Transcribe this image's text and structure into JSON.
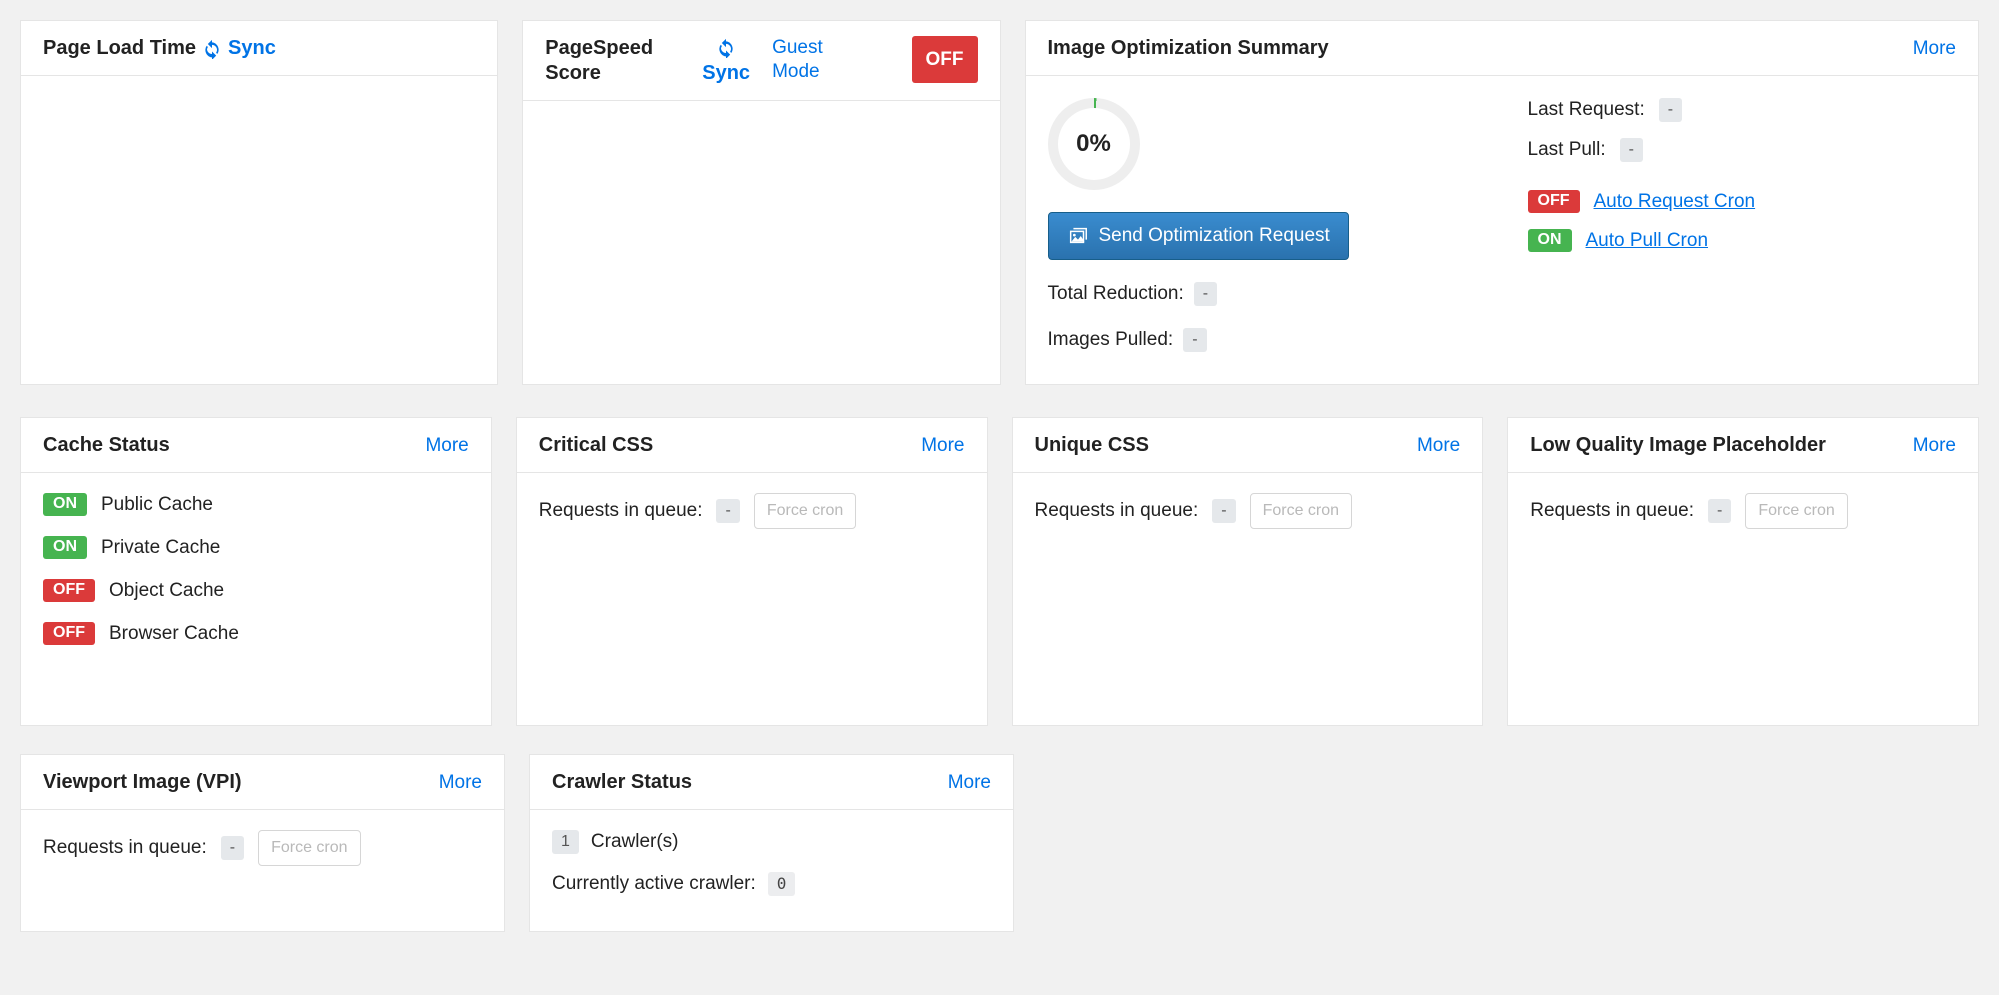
{
  "common": {
    "sync_label": "Sync",
    "more_label": "More",
    "force_cron_label": "Force cron",
    "requests_in_queue_label": "Requests in queue:",
    "off_label": "OFF",
    "on_label": "ON",
    "dash": "-"
  },
  "pageLoad": {
    "title": "Page Load Time"
  },
  "pageSpeed": {
    "title": "PageSpeed Score",
    "guest_mode_label": "Guest Mode"
  },
  "imageOpt": {
    "title": "Image Optimization Summary",
    "gauge_pct": "0%",
    "send_button": "Send Optimization Request",
    "total_reduction_label": "Total Reduction:",
    "total_reduction_val": "-",
    "images_pulled_label": "Images Pulled:",
    "images_pulled_val": "-",
    "last_request_label": "Last Request:",
    "last_request_val": "-",
    "last_pull_label": "Last Pull:",
    "last_pull_val": "-",
    "auto_request_cron_label": "Auto Request Cron",
    "auto_pull_cron_label": "Auto Pull Cron"
  },
  "cacheStatus": {
    "title": "Cache Status",
    "items": [
      {
        "state": "ON",
        "label": "Public Cache"
      },
      {
        "state": "ON",
        "label": "Private Cache"
      },
      {
        "state": "OFF",
        "label": "Object Cache"
      },
      {
        "state": "OFF",
        "label": "Browser Cache"
      }
    ]
  },
  "criticalCSS": {
    "title": "Critical CSS",
    "queue_val": "-"
  },
  "uniqueCSS": {
    "title": "Unique CSS",
    "queue_val": "-"
  },
  "lqip": {
    "title": "Low Quality Image Placeholder",
    "queue_val": "-"
  },
  "vpi": {
    "title": "Viewport Image (VPI)",
    "queue_val": "-"
  },
  "crawler": {
    "title": "Crawler Status",
    "crawlers_count": "1",
    "crawlers_label": "Crawler(s)",
    "active_label": "Currently active crawler:",
    "active_val": "0"
  }
}
